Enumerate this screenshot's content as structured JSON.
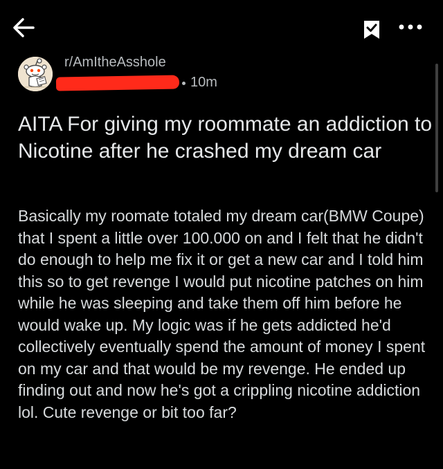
{
  "header": {
    "back_icon": "arrow-left-icon",
    "save_icon": "bookmark-check-icon",
    "more_icon": "more-horizontal-icon"
  },
  "post": {
    "subreddit": "r/AmItheAsshole",
    "time": "10m",
    "title": "AITA For giving my roommate an addiction to Nicotine after he crashed my dream car",
    "body": "Basically my roomate totaled my dream car(BMW Coupe) that I spent a little over 100.000 on and I felt that he didn't do enough to help me fix it or get a new car and I told him this so to get revenge I would put nicotine patches on him while he was sleeping and take them off him before he would wake up. My logic was if he gets addicted he'd collectively eventually spend the amount of money I spent on my car and that would be my revenge. He ended up finding out and now he's got a crippling nicotine addiction lol. Cute revenge or bit too far?"
  },
  "colors": {
    "background": "#000000",
    "text": "#d7dadc",
    "meta_text": "#b8bcbf",
    "redaction": "#ff2a1a"
  }
}
